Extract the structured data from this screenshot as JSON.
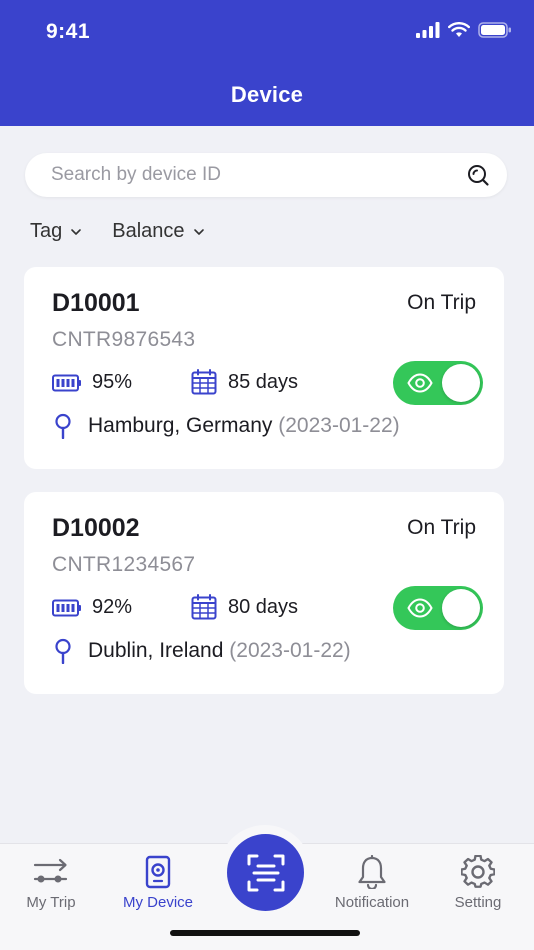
{
  "status_bar": {
    "time": "9:41"
  },
  "header": {
    "title": "Device"
  },
  "search": {
    "placeholder": "Search by device ID"
  },
  "filters": [
    {
      "label": "Tag"
    },
    {
      "label": "Balance"
    }
  ],
  "devices": [
    {
      "id": "D10001",
      "status": "On Trip",
      "container": "CNTR9876543",
      "battery": "95%",
      "days": "85 days",
      "location": "Hamburg, Germany",
      "date": "(2023-01-22)",
      "visible": true
    },
    {
      "id": "D10002",
      "status": "On Trip",
      "container": "CNTR1234567",
      "battery": "92%",
      "days": "80 days",
      "location": "Dublin, Ireland",
      "date": "(2023-01-22)",
      "visible": true
    }
  ],
  "tabbar": {
    "items": [
      {
        "label": "My Trip",
        "icon": "trip-icon"
      },
      {
        "label": "My Device",
        "icon": "device-icon",
        "active": true
      },
      {
        "label": "Scan",
        "icon": "scan-icon"
      },
      {
        "label": "Notification",
        "icon": "bell-icon"
      },
      {
        "label": "Setting",
        "icon": "gear-icon"
      }
    ]
  },
  "colors": {
    "primary": "#3a43cc",
    "toggle_on": "#34c759",
    "background": "#f0f1f6"
  }
}
